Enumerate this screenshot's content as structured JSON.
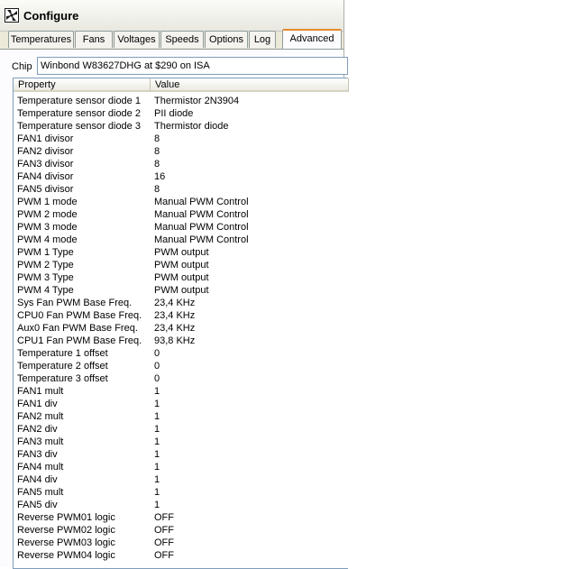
{
  "window": {
    "title": "Configure"
  },
  "tabs": [
    {
      "label": "Temperatures"
    },
    {
      "label": "Fans"
    },
    {
      "label": "Voltages"
    },
    {
      "label": "Speeds"
    },
    {
      "label": "Options"
    },
    {
      "label": "Log"
    },
    {
      "label": "Advanced"
    }
  ],
  "active_tab": "Advanced",
  "chip": {
    "label": "Chip",
    "value": "Winbond W83627DHG at $290 on ISA"
  },
  "table": {
    "columns": [
      "Property",
      "Value"
    ],
    "rows": [
      [
        "Temperature sensor diode 1",
        "Thermistor 2N3904"
      ],
      [
        "Temperature sensor diode 2",
        "PII diode"
      ],
      [
        "Temperature sensor diode 3",
        "Thermistor diode"
      ],
      [
        "FAN1 divisor",
        "8"
      ],
      [
        "FAN2 divisor",
        "8"
      ],
      [
        "FAN3 divisor",
        "8"
      ],
      [
        "FAN4 divisor",
        "16"
      ],
      [
        "FAN5 divisor",
        "8"
      ],
      [
        "PWM 1 mode",
        "Manual PWM Control"
      ],
      [
        "PWM 2 mode",
        "Manual PWM Control"
      ],
      [
        "PWM 3 mode",
        "Manual PWM Control"
      ],
      [
        "PWM 4 mode",
        "Manual PWM Control"
      ],
      [
        "PWM 1 Type",
        "PWM output"
      ],
      [
        "PWM 2 Type",
        "PWM output"
      ],
      [
        "PWM 3 Type",
        "PWM output"
      ],
      [
        "PWM 4 Type",
        "PWM output"
      ],
      [
        "Sys Fan PWM Base Freq.",
        "23,4 KHz"
      ],
      [
        "CPU0 Fan PWM Base Freq.",
        "23,4 KHz"
      ],
      [
        "Aux0 Fan PWM Base Freq.",
        "23,4 KHz"
      ],
      [
        "CPU1 Fan PWM Base Freq.",
        "93,8 KHz"
      ],
      [
        "Temperature 1 offset",
        "0"
      ],
      [
        "Temperature 2 offset",
        "0"
      ],
      [
        "Temperature 3 offset",
        "0"
      ],
      [
        "FAN1 mult",
        "1"
      ],
      [
        "FAN1 div",
        "1"
      ],
      [
        "FAN2 mult",
        "1"
      ],
      [
        "FAN2 div",
        "1"
      ],
      [
        "FAN3 mult",
        "1"
      ],
      [
        "FAN3 div",
        "1"
      ],
      [
        "FAN4 mult",
        "1"
      ],
      [
        "FAN4 div",
        "1"
      ],
      [
        "FAN5 mult",
        "1"
      ],
      [
        "FAN5 div",
        "1"
      ],
      [
        "Reverse PWM01 logic",
        "OFF"
      ],
      [
        "Reverse PWM02 logic",
        "OFF"
      ],
      [
        "Reverse PWM03 logic",
        "OFF"
      ],
      [
        "Reverse PWM04 logic",
        "OFF"
      ]
    ]
  },
  "icons": {
    "app": "fan-icon"
  }
}
